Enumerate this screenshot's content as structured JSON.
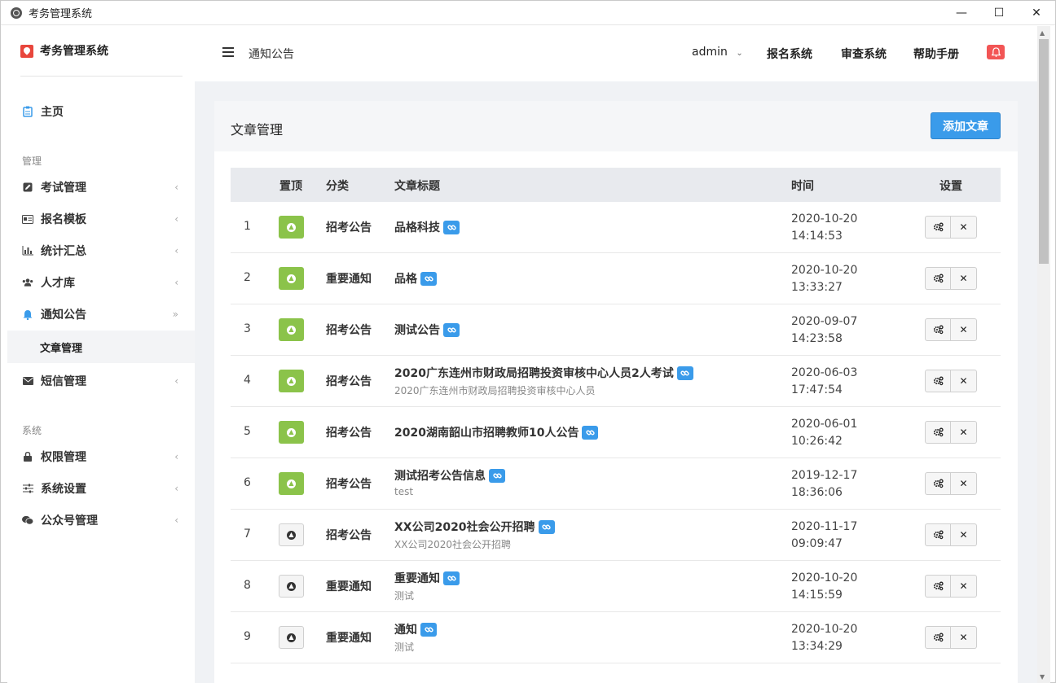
{
  "window": {
    "title": "考务管理系统",
    "minimize": "—",
    "maximize": "☐",
    "close": "✕"
  },
  "sidebar": {
    "brand": "考务管理系统",
    "home": "主页",
    "group_manage": "管理",
    "group_system": "系统",
    "items": [
      {
        "label": "考试管理",
        "icon": "edit-icon"
      },
      {
        "label": "报名模板",
        "icon": "id-card-icon"
      },
      {
        "label": "统计汇总",
        "icon": "bar-chart-icon"
      },
      {
        "label": "人才库",
        "icon": "users-icon"
      },
      {
        "label": "通知公告",
        "icon": "bell-icon"
      },
      {
        "label": "短信管理",
        "icon": "envelope-icon"
      },
      {
        "label": "权限管理",
        "icon": "lock-icon"
      },
      {
        "label": "系统设置",
        "icon": "sliders-icon"
      },
      {
        "label": "公众号管理",
        "icon": "wechat-icon"
      }
    ],
    "subitem": "文章管理"
  },
  "header": {
    "breadcrumb": "通知公告",
    "user": "admin",
    "nav": [
      "报名系统",
      "审查系统",
      "帮助手册"
    ]
  },
  "panel": {
    "title": "文章管理",
    "add_button": "添加文章"
  },
  "table": {
    "columns": [
      "置顶",
      "分类",
      "文章标题",
      "时间",
      "设置"
    ],
    "rows": [
      {
        "no": "1",
        "pinned": true,
        "category": "招考公告",
        "title": "品格科技",
        "subtitle": "",
        "date": "2020-10-20",
        "time": "14:14:53"
      },
      {
        "no": "2",
        "pinned": true,
        "category": "重要通知",
        "title": "品格",
        "subtitle": "",
        "date": "2020-10-20",
        "time": "13:33:27"
      },
      {
        "no": "3",
        "pinned": true,
        "category": "招考公告",
        "title": "测试公告",
        "subtitle": "",
        "date": "2020-09-07",
        "time": "14:23:58"
      },
      {
        "no": "4",
        "pinned": true,
        "category": "招考公告",
        "title": "2020广东连州市财政局招聘投资审核中心人员2人考试",
        "subtitle": "2020广东连州市财政局招聘投资审核中心人员",
        "date": "2020-06-03",
        "time": "17:47:54"
      },
      {
        "no": "5",
        "pinned": true,
        "category": "招考公告",
        "title": "2020湖南韶山市招聘教师10人公告",
        "subtitle": "",
        "date": "2020-06-01",
        "time": "10:26:42"
      },
      {
        "no": "6",
        "pinned": true,
        "category": "招考公告",
        "title": "测试招考公告信息",
        "subtitle": "test",
        "date": "2019-12-17",
        "time": "18:36:06"
      },
      {
        "no": "7",
        "pinned": false,
        "category": "招考公告",
        "title": "XX公司2020社会公开招聘",
        "subtitle": "XX公司2020社会公开招聘",
        "date": "2020-11-17",
        "time": "09:09:47"
      },
      {
        "no": "8",
        "pinned": false,
        "category": "重要通知",
        "title": "重要通知",
        "subtitle": "测试",
        "date": "2020-10-20",
        "time": "14:15:59"
      },
      {
        "no": "9",
        "pinned": false,
        "category": "重要通知",
        "title": "通知",
        "subtitle": "测试",
        "date": "2020-10-20",
        "time": "13:34:29"
      }
    ]
  }
}
